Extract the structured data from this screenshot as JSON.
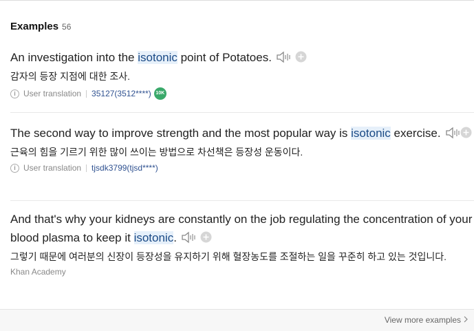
{
  "header": {
    "title": "Examples",
    "count": "56"
  },
  "examples": [
    {
      "before": "An investigation into the ",
      "term": "isotonic",
      "after": " point of Potatoes.",
      "translation": "감자의 등장 지점에 대한 조사.",
      "source": "User translation",
      "user": "35127(3512****)",
      "badge": "10K"
    },
    {
      "before": "The second way to improve strength and the most popular way is ",
      "term": "isotonic",
      "after": " exercise.",
      "translation": "근육의 힘을 기르기 위한 많이 쓰이는 방법으로 차선책은 등장성 운동이다.",
      "source": "User translation",
      "user": "tjsdk3799(tjsd****)"
    },
    {
      "before": "And that's why your kidneys are constantly on the job regulating the concentration of your blood plasma to keep it ",
      "term": "isotonic",
      "after": ".",
      "translation": "그렇기 때문에 여러분의 신장이 등장성을 유지하기 위해 혈장농도를 조절하는 일을 꾸준히 하고 있는 것입니다.",
      "credit": "Khan Academy"
    }
  ],
  "footer": {
    "view_more": "View more examples"
  },
  "icons": {
    "speaker": "speaker-icon",
    "add": "plus-circle-icon",
    "info": "info-icon",
    "chevron": "chevron-right-icon"
  },
  "colors": {
    "highlight_bg": "#e6f0fa",
    "badge_green": "#3aa96a",
    "user_link": "#2f5190"
  }
}
